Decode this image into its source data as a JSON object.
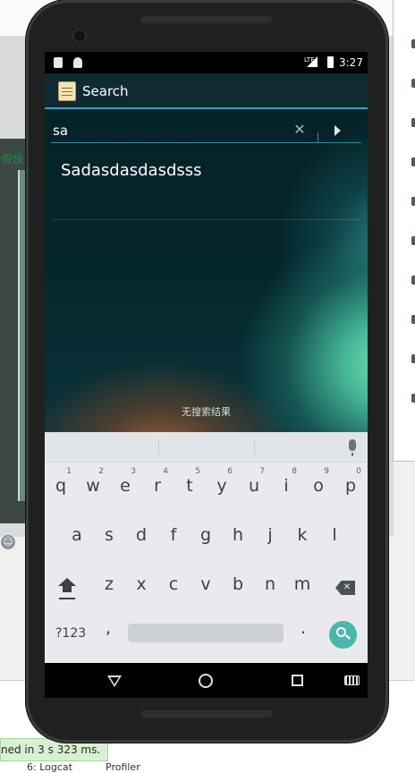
{
  "ide": {
    "side_label": "假快",
    "status_message": "ned in 3 s 323 ms.",
    "bottom_tabs": [
      "6: Logcat",
      "Profiler"
    ]
  },
  "status_bar": {
    "network": "LTE",
    "time": "3:27"
  },
  "app": {
    "title": "Search",
    "search": {
      "value": "sa",
      "placeholder": ""
    },
    "results": [
      "Sadasdasdasdsss"
    ],
    "empty_message": "无搜索结果"
  },
  "keyboard": {
    "row1": [
      {
        "key": "q",
        "hint": "1"
      },
      {
        "key": "w",
        "hint": "2"
      },
      {
        "key": "e",
        "hint": "3"
      },
      {
        "key": "r",
        "hint": "4"
      },
      {
        "key": "t",
        "hint": "5"
      },
      {
        "key": "y",
        "hint": "6"
      },
      {
        "key": "u",
        "hint": "7"
      },
      {
        "key": "i",
        "hint": "8"
      },
      {
        "key": "o",
        "hint": "9"
      },
      {
        "key": "p",
        "hint": "0"
      }
    ],
    "row2": [
      "a",
      "s",
      "d",
      "f",
      "g",
      "h",
      "j",
      "k",
      "l"
    ],
    "row3": [
      "z",
      "x",
      "c",
      "v",
      "b",
      "n",
      "m"
    ],
    "symbols_label": "?123",
    "comma": ",",
    "period": "."
  },
  "colors": {
    "accent": "#36a3c2",
    "search_key": "#4db6ac",
    "keyboard_bg": "#e8eaed"
  },
  "icons": {
    "app": "notepad-icon",
    "clear": "close-icon",
    "go": "play-arrow-icon",
    "mic": "mic-icon",
    "search_key": "search-icon"
  }
}
